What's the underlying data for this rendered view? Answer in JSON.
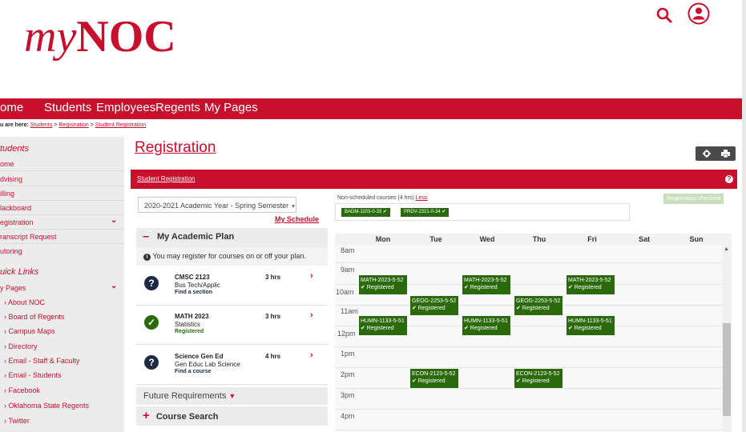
{
  "header": {
    "logo_my": "my",
    "logo_noc": "NOC",
    "search_icon": "search-icon",
    "user_icon": "user-circle-icon"
  },
  "colors": {
    "brand": "#c8102e",
    "registered": "#2b6a0c",
    "panel": "#ececec"
  },
  "nav": {
    "items": [
      "ome",
      "Students",
      "Employees",
      "Regents",
      "My Pages"
    ]
  },
  "breadcrumb": {
    "prefix": "u are here:",
    "links": [
      "Students",
      "Registration",
      "Student Registration"
    ],
    "sep": ">"
  },
  "sidebar": {
    "section1_title": "tudents",
    "section1_items": [
      "ome",
      "dvising",
      "illing",
      "lackboard",
      "egistration",
      "ranscript Request",
      "utoring"
    ],
    "section2_title": "uick Links",
    "section2_items": [
      "y Pages",
      "About NOC",
      "Board of Regents",
      "Campus Maps",
      "Directory",
      "Email - Staff & Faculty",
      "Email - Students",
      "Facebook",
      "Oklahoma State Regents",
      "Twitter"
    ]
  },
  "main": {
    "title": "Registration",
    "toolbar_icons": [
      "gear-icon",
      "print-icon"
    ],
    "panel_title": "Student Registration",
    "help_icon": "?",
    "semester": "2020-2021 Academic Year - Spring Semester",
    "my_schedule": "My Schedule",
    "plan_title": "My Academic Plan",
    "plan_info": "You may register for courses on or off your plan.",
    "courses": [
      {
        "code": "CMSC 2123",
        "desc": "Bus Tech/Applic",
        "status": "Find a section",
        "hrs": "3 hrs",
        "state": "question"
      },
      {
        "code": "MATH 2023",
        "desc": "Statistics",
        "status": "Registered",
        "hrs": "3 hrs",
        "state": "done"
      },
      {
        "code": "Science Gen Ed",
        "desc": "Gen Educ Lab Science",
        "status": "Find a course",
        "hrs": "4 hrs",
        "state": "question"
      }
    ],
    "future_requirements": "Future Requirements",
    "course_search": "Course Search"
  },
  "schedule": {
    "nonscheduled_text": "Non-scheduled courses (4 hrs)",
    "less_link": "Less",
    "nonscheduled_chips": [
      "BADM-1103-0-33 ✔",
      "PRDV-2321-0-34 ✔"
    ],
    "checkout": "Registration checkout",
    "days": [
      "Mon",
      "Tue",
      "Wed",
      "Thu",
      "Fri",
      "Sat",
      "Sun"
    ],
    "hours": [
      "8am",
      "9am",
      "10am",
      "11am",
      "12pm",
      "1pm",
      "2pm",
      "3pm",
      "4pm"
    ],
    "registered_label": "✔ Registered",
    "blocks": [
      {
        "course": "MATH-2023-5-52",
        "day": "Mon",
        "start": "9:30am"
      },
      {
        "course": "MATH-2023-5-52",
        "day": "Wed",
        "start": "9:30am"
      },
      {
        "course": "MATH-2023-5-52",
        "day": "Fri",
        "start": "9:30am"
      },
      {
        "course": "GEOG-2253-5-52",
        "day": "Tue",
        "start": "10:30am"
      },
      {
        "course": "GEOG-2253-5-52",
        "day": "Thu",
        "start": "10:30am"
      },
      {
        "course": "HUMN-1133-5-51",
        "day": "Mon",
        "start": "11:15am"
      },
      {
        "course": "HUMN-1133-5-51",
        "day": "Wed",
        "start": "11:15am"
      },
      {
        "course": "HUMN-1133-5-51",
        "day": "Fri",
        "start": "11:15am"
      },
      {
        "course": "ECON-2123-5-52",
        "day": "Tue",
        "start": "2pm"
      },
      {
        "course": "ECON-2123-5-52",
        "day": "Thu",
        "start": "2pm"
      }
    ]
  }
}
